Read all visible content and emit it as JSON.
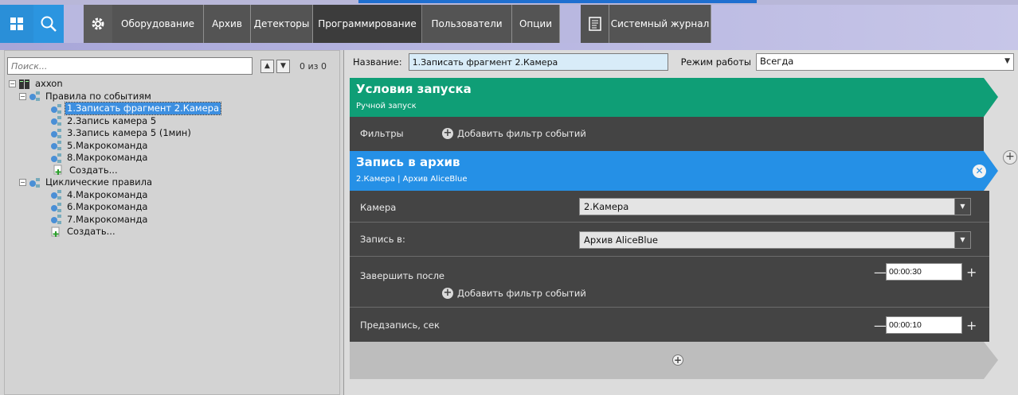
{
  "nav": {
    "items": [
      {
        "label": "Оборудование"
      },
      {
        "label": "Архив"
      },
      {
        "label": "Детекторы"
      },
      {
        "label": "Программирование"
      },
      {
        "label": "Пользователи"
      },
      {
        "label": "Опции"
      },
      {
        "label": "Системный журнал"
      }
    ],
    "active": "Программирование",
    "icons": [
      "grid-logo-icon",
      "search-icon",
      "gear-icon",
      "journal-icon"
    ]
  },
  "left": {
    "search": {
      "placeholder": "Поиск...",
      "value": ""
    },
    "counter": "0 из 0",
    "tree": {
      "root": "axxon",
      "groups": [
        {
          "label": "Правила по событиям",
          "items": [
            {
              "label": "1.Записать фрагмент 2.Камера",
              "selected": true
            },
            {
              "label": "2.Запись камера 5"
            },
            {
              "label": "3.Запись камера 5 (1мин)"
            },
            {
              "label": "5.Макрокоманда"
            },
            {
              "label": "8.Макрокоманда"
            }
          ],
          "create": "Создать..."
        },
        {
          "label": "Циклические правила",
          "items": [
            {
              "label": "4.Макрокоманда"
            },
            {
              "label": "6.Макрокоманда"
            },
            {
              "label": "7.Макрокоманда"
            }
          ],
          "create": "Создать..."
        }
      ]
    }
  },
  "right": {
    "name_label": "Название:",
    "name_value": "1.Записать фрагмент 2.Камера",
    "mode_label": "Режим работы",
    "mode_value": "Всегда",
    "conditions": {
      "title": "Условия запуска",
      "subtitle": "Ручной запуск"
    },
    "filters": {
      "label": "Фильтры",
      "add_label": "Добавить фильтр событий"
    },
    "action": {
      "title": "Запись в архив",
      "subtitle": "2.Камера | Архив AliceBlue"
    },
    "params": {
      "camera": {
        "label": "Камера",
        "value": "2.Камера"
      },
      "record_to": {
        "label": "Запись в:",
        "value": "Архив AliceBlue"
      },
      "finish_after": {
        "label": "Завершить после",
        "value": "00:00:30",
        "add_label": "Добавить фильтр событий"
      },
      "prerecord": {
        "label": "Предзапись, сек",
        "value": "00:00:10"
      }
    },
    "colors": {
      "conditions": "#0f9e76",
      "action": "#2590e6",
      "dark": "#444444",
      "selected": "#3d8fe0"
    }
  }
}
